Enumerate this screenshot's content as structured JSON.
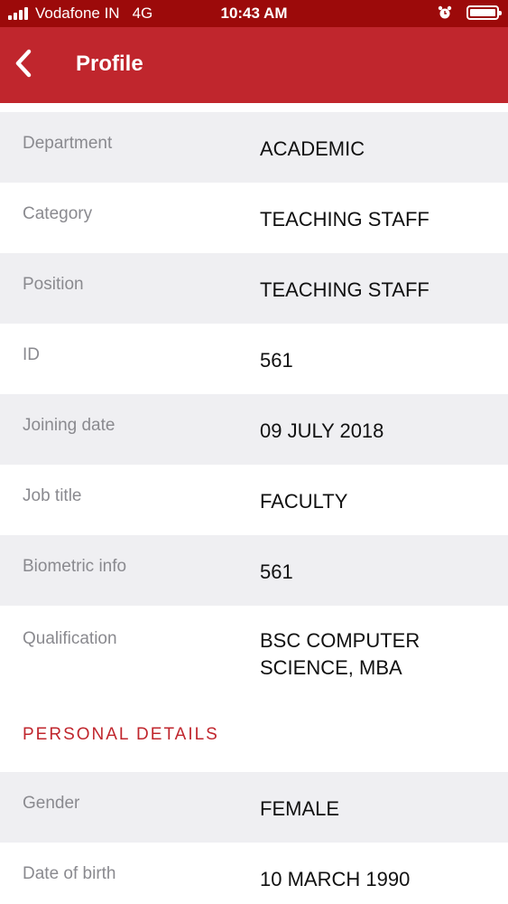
{
  "status_bar": {
    "carrier": "Vodafone IN",
    "network": "4G",
    "time": "10:43 AM",
    "icons": [
      "signal-bars-icon",
      "alarm-icon",
      "battery-icon"
    ]
  },
  "header": {
    "back_icon": "chevron-left-icon",
    "title": "Profile"
  },
  "colors": {
    "status_bar": "#9c0a0a",
    "nav_bar": "#c0262d",
    "section_title": "#c0262d",
    "row_gray": "#efeff2",
    "label_text": "#8a8a8f",
    "value_text": "#111111"
  },
  "details": [
    {
      "label": "Department",
      "value": "ACADEMIC"
    },
    {
      "label": "Category",
      "value": "TEACHING STAFF"
    },
    {
      "label": "Position",
      "value": "TEACHING STAFF"
    },
    {
      "label": "ID",
      "value": "561"
    },
    {
      "label": "Joining date",
      "value": "09 JULY 2018"
    },
    {
      "label": "Job title",
      "value": "FACULTY"
    },
    {
      "label": "Biometric info",
      "value": "561"
    },
    {
      "label": "Qualification",
      "value": "BSC COMPUTER SCIENCE, MBA"
    }
  ],
  "personal_section": {
    "title": "PERSONAL DETAILS",
    "items": [
      {
        "label": "Gender",
        "value": "FEMALE"
      },
      {
        "label": "Date of birth",
        "value": "10 MARCH 1990"
      }
    ]
  }
}
